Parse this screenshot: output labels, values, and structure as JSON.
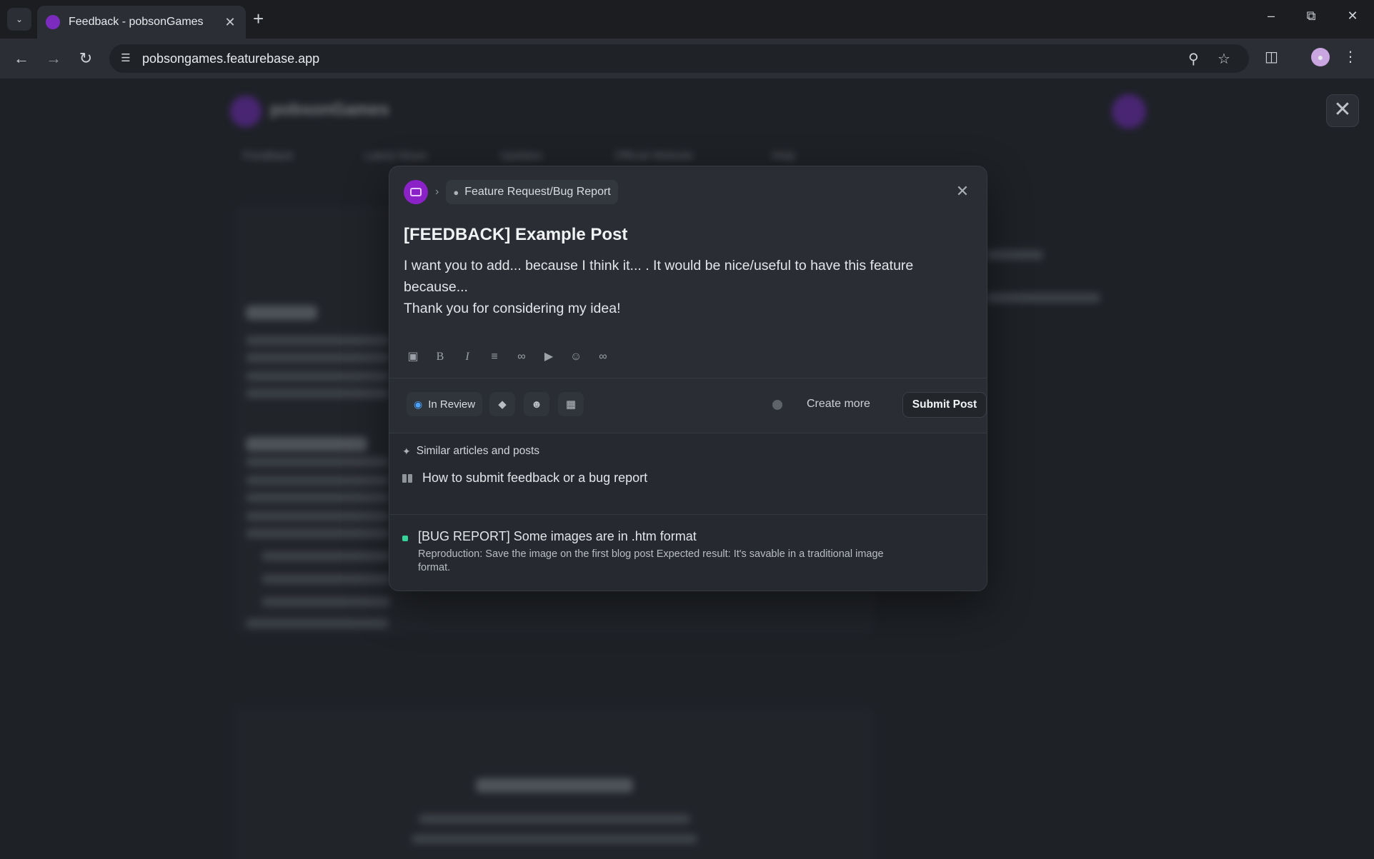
{
  "browser": {
    "tab_title": "Feedback - pobsonGames",
    "new_tab": "+",
    "url": "pobsongames.featurebase.app"
  },
  "background": {
    "brand": "pobsonGames",
    "nav": [
      "Feedback",
      "Latest News",
      "Updates",
      "Official Website",
      "Help"
    ]
  },
  "modal": {
    "category": "Feature Request/Bug Report",
    "title": "[FEEDBACK] Example Post",
    "body_line1": "I want you to add... because I think it... . It would be nice/useful to have this feature because...",
    "body_line2": "Thank you for considering my idea!",
    "editor_tools": [
      "image-icon",
      "bold-icon",
      "italic-icon",
      "list-icon",
      "link-icon",
      "video-icon",
      "emoji-icon",
      "attachment-icon"
    ],
    "status": "In Review",
    "create_more": "Create more",
    "submit": "Submit Post",
    "similar_heading": "Similar articles and posts",
    "article": "How to submit feedback or a bug report",
    "post_title": "[BUG REPORT] Some images are in .htm format",
    "post_desc": "Reproduction: Save the image on the first blog post Expected result: It's savable in a traditional image format.",
    "post_status_color": "#34d399"
  },
  "colors": {
    "accent": "#8b22c8",
    "status_blue": "#4aa3ff"
  }
}
